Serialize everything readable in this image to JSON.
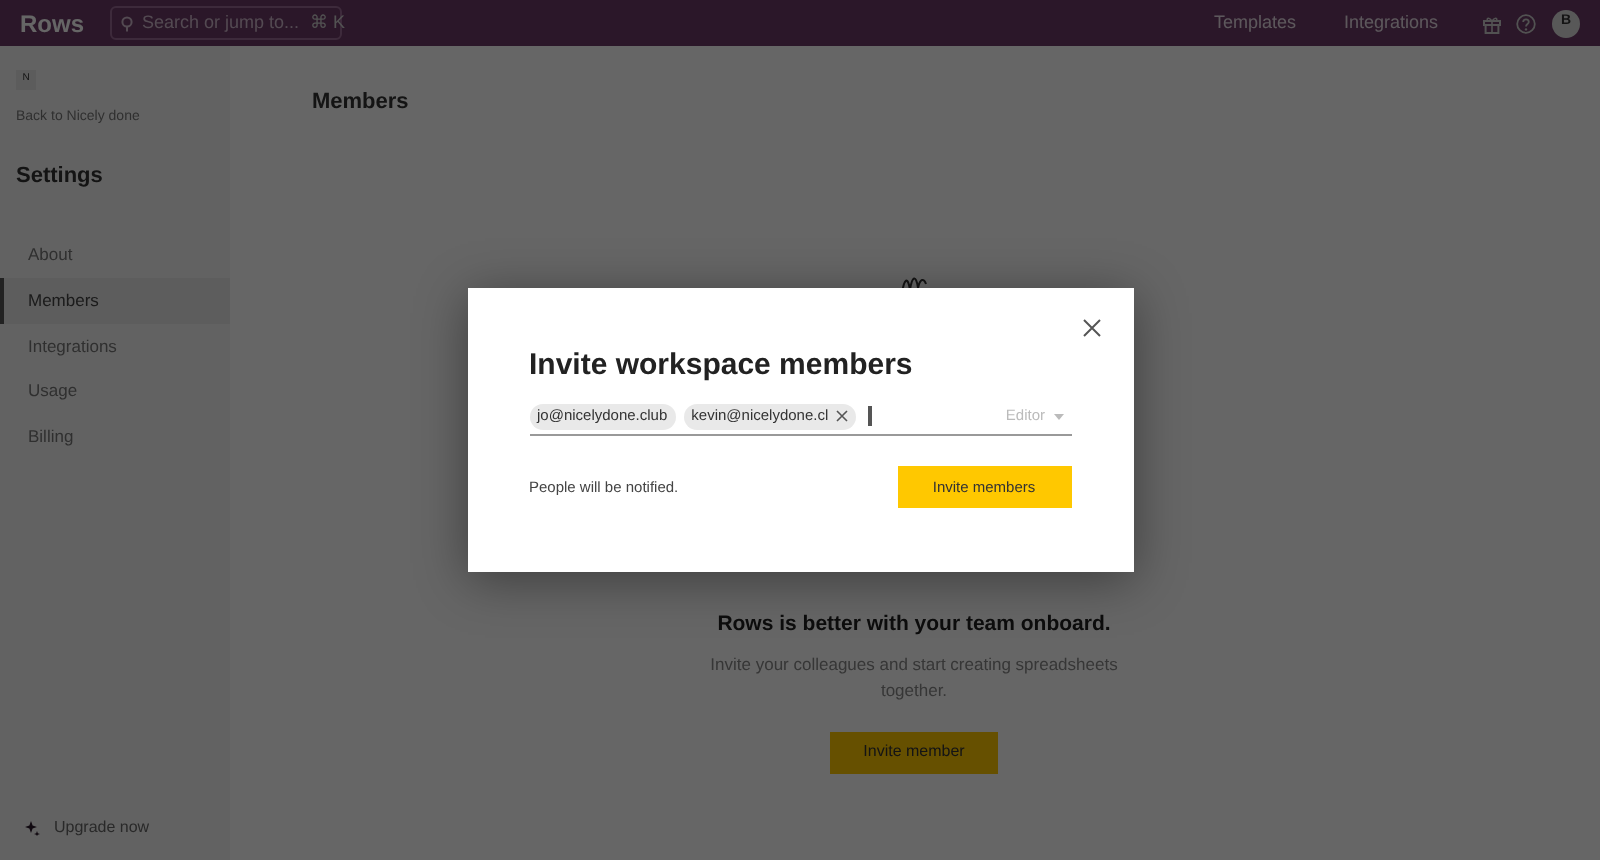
{
  "topbar": {
    "logo": "Rows",
    "search": {
      "placeholder": "Search or jump to...",
      "shortcut": "⌘ K"
    },
    "links": [
      {
        "label": "Templates"
      },
      {
        "label": "Integrations"
      }
    ],
    "avatar": "B"
  },
  "sidebar": {
    "workspace_badge": "N",
    "back_link": "Back to Nicely done",
    "title": "Settings",
    "items": [
      {
        "label": "About",
        "selected": false
      },
      {
        "label": "Members",
        "selected": true
      },
      {
        "label": "Integrations",
        "selected": false
      },
      {
        "label": "Usage",
        "selected": false
      },
      {
        "label": "Billing",
        "selected": false
      }
    ],
    "upgrade": "Upgrade now"
  },
  "page": {
    "title": "Members",
    "empty_state": {
      "heading": "Rows is better with your team onboard.",
      "text": "Invite your colleagues and start creating spreadsheets together.",
      "button": "Invite member"
    }
  },
  "modal": {
    "title": "Invite workspace members",
    "chips": [
      {
        "label": "jo@nicelydone.club",
        "removable": false
      },
      {
        "label": "kevin@nicelydone.cl",
        "removable": true
      }
    ],
    "role": "Editor",
    "note": "People will be notified.",
    "button": "Invite members"
  }
}
